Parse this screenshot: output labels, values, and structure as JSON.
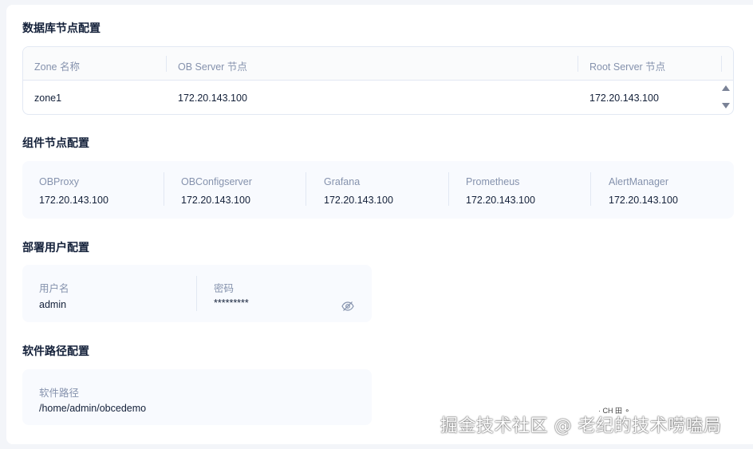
{
  "db_section": {
    "title": "数据库节点配置",
    "columns": [
      "Zone 名称",
      "OB Server 节点",
      "Root Server 节点"
    ],
    "rows": [
      {
        "zone": "zone1",
        "ob_server": "172.20.143.100",
        "root_server": "172.20.143.100"
      }
    ]
  },
  "component_section": {
    "title": "组件节点配置",
    "items": [
      {
        "label": "OBProxy",
        "value": "172.20.143.100"
      },
      {
        "label": "OBConfigserver",
        "value": "172.20.143.100"
      },
      {
        "label": "Grafana",
        "value": "172.20.143.100"
      },
      {
        "label": "Prometheus",
        "value": "172.20.143.100"
      },
      {
        "label": "AlertManager",
        "value": "172.20.143.100"
      }
    ]
  },
  "user_section": {
    "title": "部署用户配置",
    "username_label": "用户名",
    "username_value": "admin",
    "password_label": "密码",
    "password_value": "*********",
    "toggle_icon": "eye-invisible-icon"
  },
  "path_section": {
    "title": "软件路径配置",
    "path_label": "软件路径",
    "path_value": "/home/admin/obcedemo"
  },
  "watermark": {
    "text": "掘金技术社区 @ 老纪的技术唠嗑局",
    "glyphs": "·  CH  田  ⚬"
  }
}
